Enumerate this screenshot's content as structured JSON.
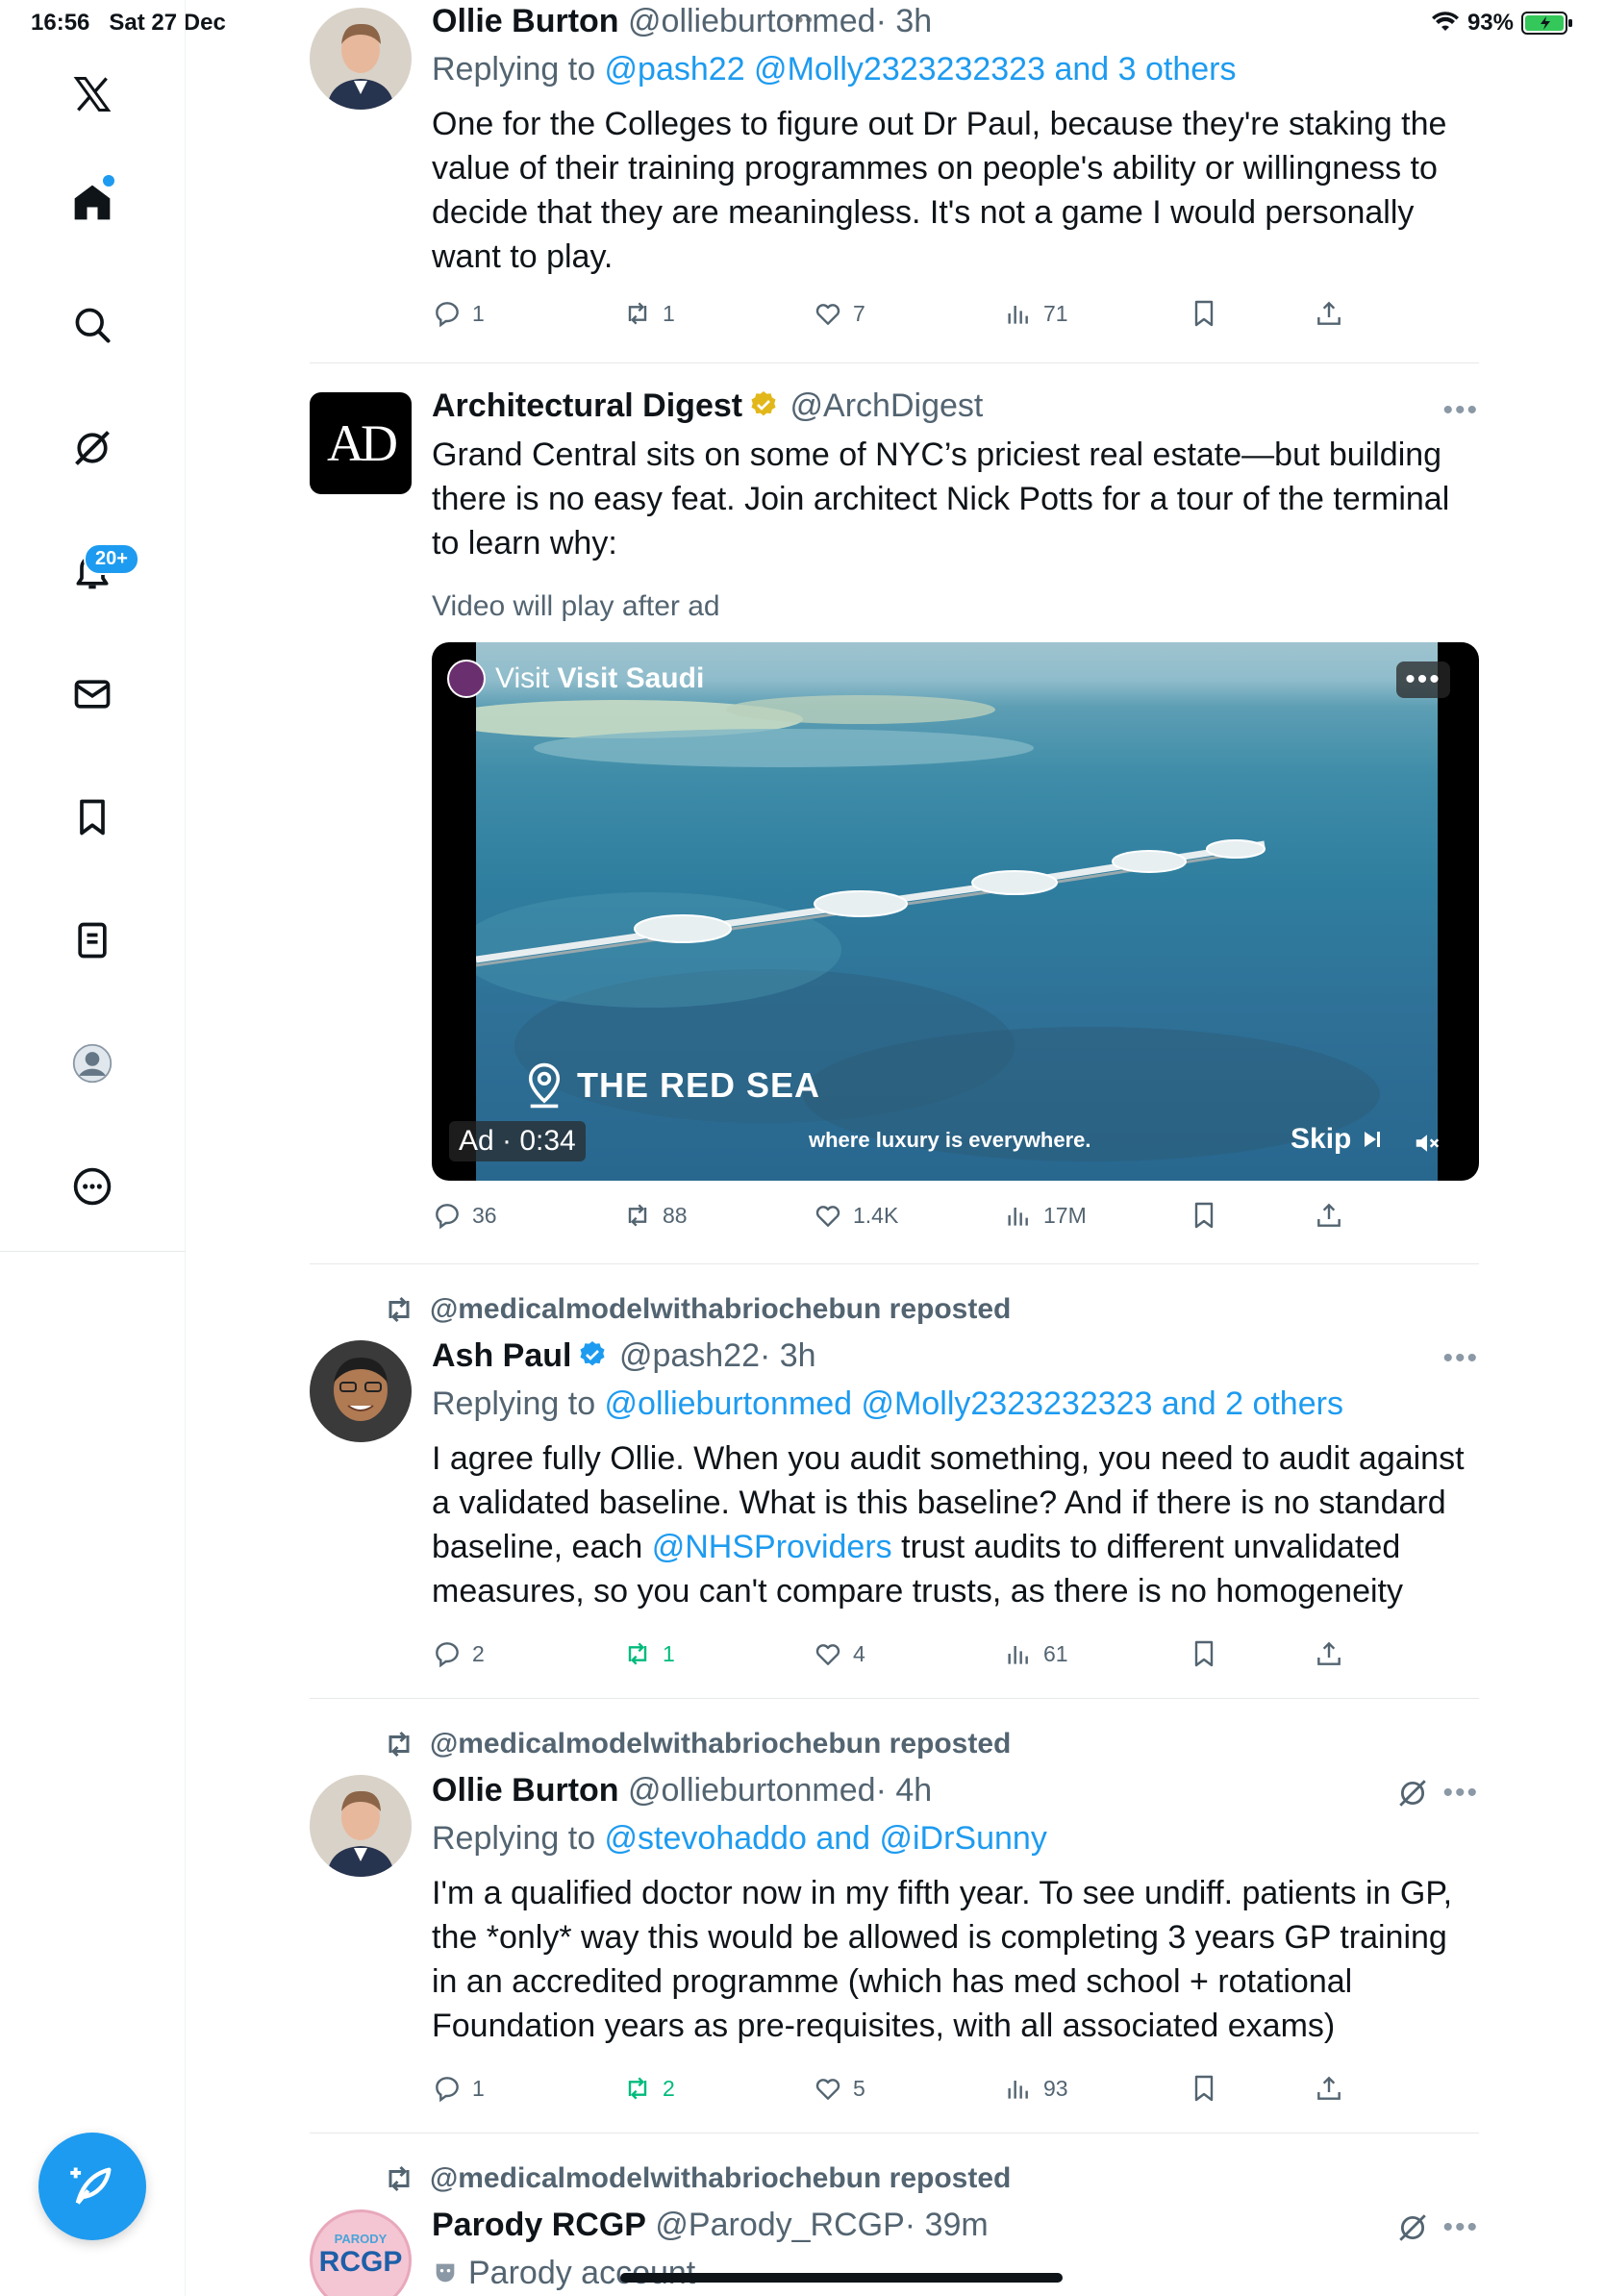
{
  "status_bar": {
    "time": "16:56",
    "date": "Sat 27 Dec",
    "battery": "93%"
  },
  "sidebar": {
    "notifications_badge": "20+"
  },
  "tweets": [
    {
      "name": "Ollie Burton",
      "handle": "@ollieburtonmed",
      "time": "· 3h",
      "reply_prefix": "Replying to ",
      "reply_to": "@pash22 @Molly2323232323 and 3 others",
      "text": "One for the Colleges to figure out Dr Paul, because they're staking the value of their training programmes on people's ability or willingness to decide that they are meaningless. It's not a game I would personally want to play.",
      "replies": "1",
      "reposts": "1",
      "likes": "7",
      "views": "71"
    },
    {
      "name": "Architectural Digest",
      "handle": "@ArchDigest",
      "avatar_text": "AD",
      "text": "Grand Central sits on some of NYC’s priciest real estate—but building there is no easy feat. Join architect Nick Potts for a tour of the terminal to learn why:",
      "ad_note": "Video will play after ad",
      "video": {
        "advertiser_prefix": "Visit ",
        "advertiser": "Visit Saudi",
        "location": "THE RED SEA",
        "ad_time": "Ad · 0:34",
        "tagline": "where luxury is everywhere.",
        "skip": "Skip"
      },
      "replies": "36",
      "reposts": "88",
      "likes": "1.4K",
      "views": "17M"
    },
    {
      "reposted_by": "@medicalmodelwithabriochebun reposted",
      "name": "Ash Paul",
      "handle": "@pash22",
      "time": "· 3h",
      "reply_prefix": "Replying to ",
      "reply_to": "@ollieburtonmed @Molly2323232323 and 2 others",
      "text_1": "I agree fully Ollie. When you audit something, you need to audit against a validated baseline. What is this baseline? And if there is no standard baseline, each ",
      "mention": "@NHSProviders",
      "text_2": " trust audits to different unvalidated measures, so you can't compare trusts, as there is no homogeneity",
      "replies": "2",
      "reposts": "1",
      "likes": "4",
      "views": "61"
    },
    {
      "reposted_by": "@medicalmodelwithabriochebun reposted",
      "name": "Ollie Burton",
      "handle": "@ollieburtonmed",
      "time": "· 4h",
      "reply_prefix": "Replying to ",
      "reply_to": "@stevohaddo and @iDrSunny",
      "text": "I'm a qualified doctor now in my fifth year. To see undiff. patients in GP, the *only* way this would be allowed is completing 3 years GP training in an accredited programme (which has med school + rotational Foundation years as pre-requisites, with all associated exams)",
      "replies": "1",
      "reposts": "2",
      "likes": "5",
      "views": "93"
    },
    {
      "reposted_by": "@medicalmodelwithabriochebun reposted",
      "name": "Parody RCGP",
      "handle": "@Parody_RCGP",
      "time": "· 39m",
      "avatar_top": "PARODY",
      "avatar_text": "RCGP",
      "label": "Parody account"
    }
  ],
  "colors": {
    "accent": "#1d9bf0",
    "repost_green": "#00ba7c",
    "secondary": "#536471",
    "verified_gold": "#e2b719"
  }
}
